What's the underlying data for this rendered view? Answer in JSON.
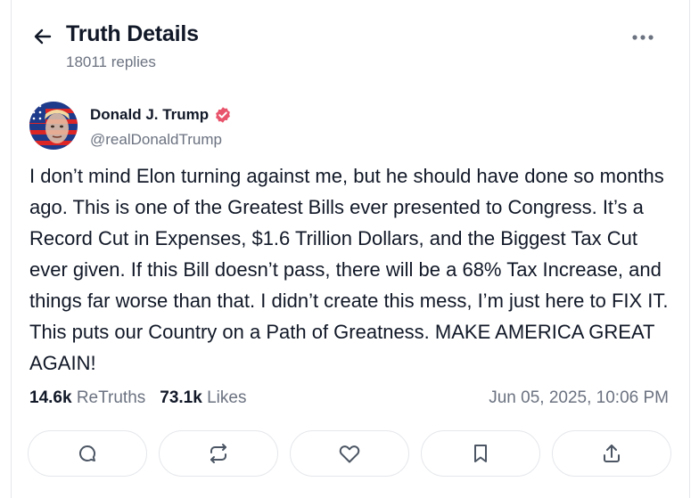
{
  "header": {
    "title": "Truth Details",
    "reply_count": "18011 replies"
  },
  "post": {
    "author_name": "Donald J. Trump",
    "author_handle": "@realDonaldTrump",
    "body": "I don’t mind Elon turning against me, but he should have done so months ago. This is one of the Greatest Bills ever presented to Congress. It’s a Record Cut in Expenses, $1.6 Trillion Dollars, and the Biggest Tax Cut ever given. If this Bill doesn’t pass, there will be a 68% Tax Increase, and things far worse than that. I didn’t create this mess, I’m just here to FIX IT. This puts our Country on a Path of Greatness. MAKE AMERICA GREAT AGAIN!",
    "retruths_count": "14.6k",
    "retruths_label": "ReTruths",
    "likes_count": "73.1k",
    "likes_label": "Likes",
    "timestamp": "Jun 05, 2025, 10:06 PM"
  },
  "icons": {
    "back": "arrow-left-icon",
    "more": "more-horizontal-icon",
    "verified": "verified-badge-icon",
    "reply": "comment-icon",
    "retruth": "repost-icon",
    "like": "heart-icon",
    "bookmark": "bookmark-icon",
    "share": "share-icon"
  },
  "colors": {
    "verified": "#e8546b",
    "text": "#111827",
    "muted": "#6b7280",
    "border": "#e5e7eb"
  }
}
